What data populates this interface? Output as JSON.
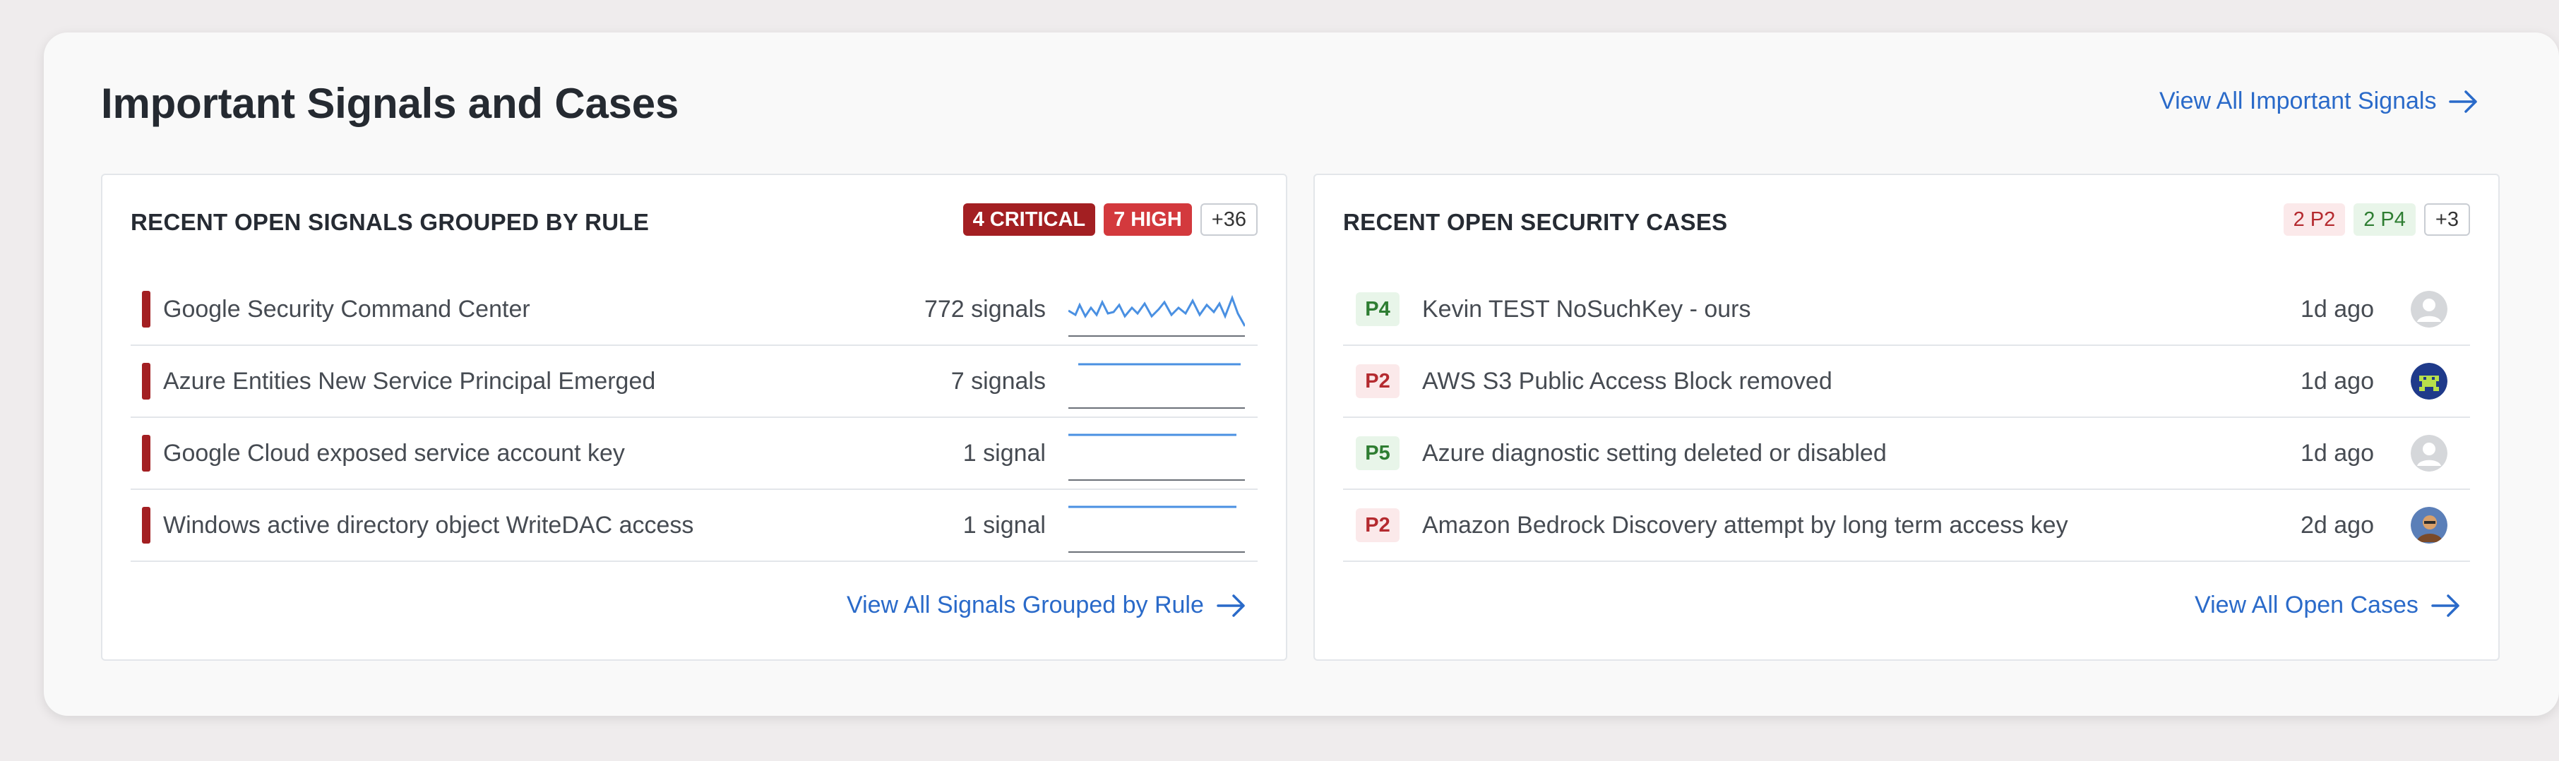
{
  "panel": {
    "title": "Important Signals and Cases",
    "view_all_label": "View All Important Signals"
  },
  "signals": {
    "title": "RECENT OPEN SIGNALS GROUPED BY RULE",
    "badges": {
      "critical": "4 CRITICAL",
      "high": "7 HIGH",
      "more": "+36"
    },
    "rows": [
      {
        "name": "Google Security Command Center",
        "count": "772 signals",
        "severity": "critical",
        "trend": "spiky"
      },
      {
        "name": "Azure Entities New Service Principal Emerged",
        "count": "7 signals",
        "severity": "critical",
        "trend": "flat"
      },
      {
        "name": "Google Cloud exposed service account key",
        "count": "1 signal",
        "severity": "critical",
        "trend": "flat"
      },
      {
        "name": "Windows active directory object WriteDAC access",
        "count": "1 signal",
        "severity": "critical",
        "trend": "flat"
      }
    ],
    "view_all_label": "View All Signals Grouped by Rule"
  },
  "cases": {
    "title": "RECENT OPEN SECURITY CASES",
    "badges": {
      "p2": "2 P2",
      "p4": "2 P4",
      "more": "+3"
    },
    "rows": [
      {
        "priority": "P4",
        "name": "Kevin TEST NoSuchKey - ours",
        "age": "1d ago",
        "assignee_icon": "default-avatar-icon"
      },
      {
        "priority": "P2",
        "name": "AWS S3 Public Access Block removed",
        "age": "1d ago",
        "assignee_icon": "pixel-avatar-icon"
      },
      {
        "priority": "P5",
        "name": "Azure diagnostic setting deleted or disabled",
        "age": "1d ago",
        "assignee_icon": "default-avatar-icon"
      },
      {
        "priority": "P2",
        "name": "Amazon Bedrock Discovery attempt by long term access key",
        "age": "2d ago",
        "assignee_icon": "photo-avatar-icon"
      }
    ],
    "view_all_label": "View All Open Cases"
  },
  "colors": {
    "link": "#2a6ac9",
    "critical": "#a31f22",
    "high": "#d3393d",
    "sparkline": "#4a90e2"
  }
}
